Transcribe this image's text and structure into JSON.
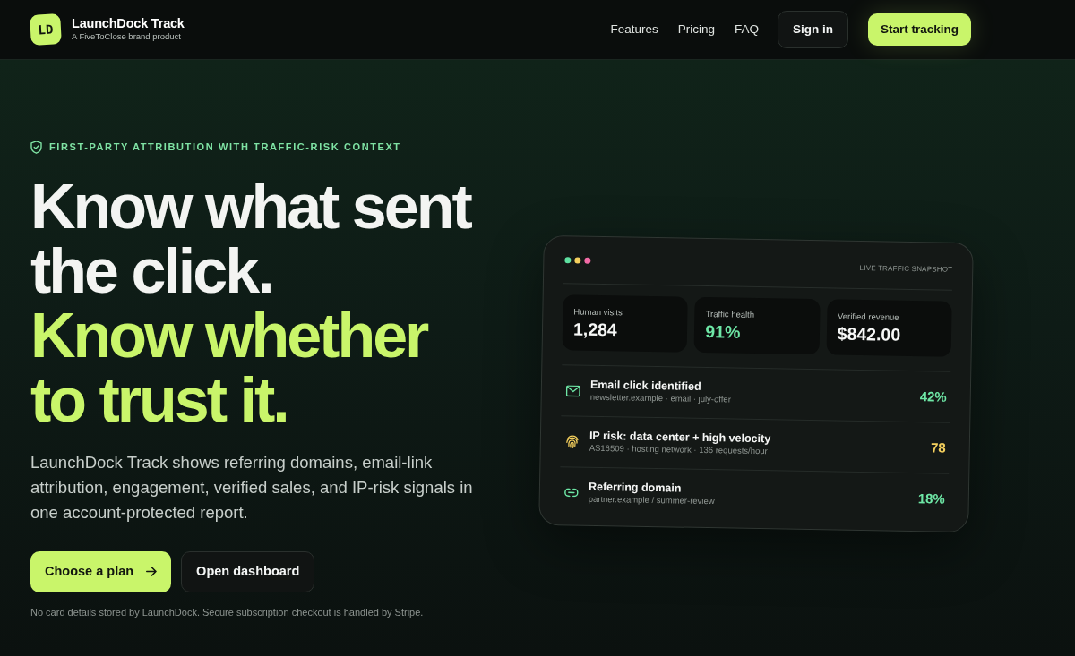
{
  "brand": {
    "logo_text": "LD",
    "name": "LaunchDock Track",
    "tagline": "A FiveToClose brand product"
  },
  "nav": {
    "links": [
      "Features",
      "Pricing",
      "FAQ"
    ],
    "buttons": [
      {
        "label": "Sign in",
        "kind": "secondary"
      },
      {
        "label": "Start tracking",
        "kind": "primary"
      }
    ]
  },
  "hero": {
    "eyebrow": "FIRST-PARTY ATTRIBUTION WITH TRAFFIC-RISK CONTEXT",
    "headline": [
      {
        "text": "Know what sent the click.",
        "highlighted": false
      },
      {
        "text": "Know whether to trust it.",
        "highlighted": true
      }
    ],
    "description": "LaunchDock Track shows referring domains, email-link attribution, engagement, verified sales, and IP-risk signals in one account-protected report.",
    "buttons": [
      {
        "label": "Choose a plan",
        "kind": "primary"
      },
      {
        "label": "Open dashboard",
        "kind": "secondary"
      }
    ],
    "note": "No card details stored by LaunchDock. Secure subscription checkout is handled by Stripe."
  },
  "snapshot": {
    "window_dots": [
      {
        "color": "#5ee0a0"
      },
      {
        "color": "#f4cf5d"
      },
      {
        "color": "#f26ba6"
      }
    ],
    "title": "LIVE TRAFFIC SNAPSHOT",
    "stats": [
      {
        "label": "Human visits",
        "value": "1,284",
        "highlighted": false
      },
      {
        "label": "Traffic health",
        "value": "91%",
        "highlighted": true
      },
      {
        "label": "Verified revenue",
        "value": "$842.00",
        "highlighted": false
      }
    ],
    "rows": [
      {
        "kind": "email",
        "title": "Email click identified",
        "detail": "newsletter.example · email · july-offer",
        "value": "42%",
        "color": "#6ee7a6"
      },
      {
        "kind": "ip_risk",
        "title": "IP risk: data center + high velocity",
        "detail": "AS16509 · hosting network · 136 requests/hour",
        "value": "78",
        "color": "#f4cf5d"
      },
      {
        "kind": "referrer",
        "title": "Referring domain",
        "detail": "partner.example / summer-review",
        "value": "18%",
        "color": "#6ee7a6"
      }
    ]
  }
}
